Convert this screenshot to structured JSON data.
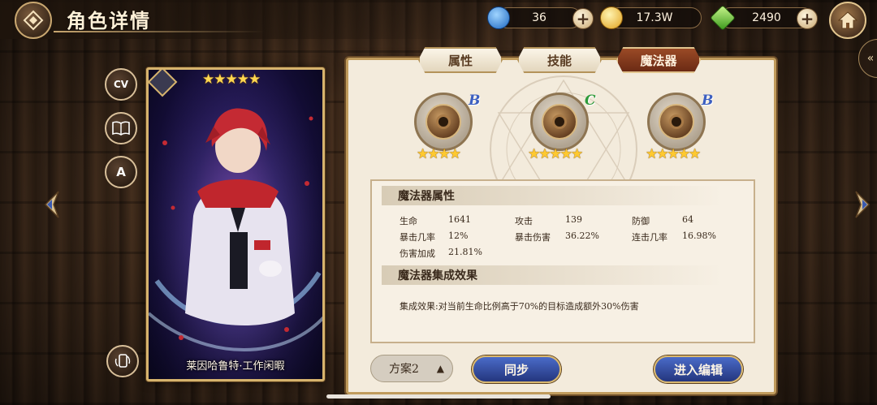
{
  "header": {
    "title": "角色详情",
    "resources": [
      {
        "name": "gem",
        "value": "36",
        "color": "#3b8fe0"
      },
      {
        "name": "gold",
        "value": "17.3W",
        "color": "#f2c23b"
      },
      {
        "name": "crystal",
        "value": "2490",
        "color": "#7ccf3c"
      }
    ],
    "plus": "+"
  },
  "side_buttons": [
    {
      "name": "cv-button",
      "label": "CV"
    },
    {
      "name": "story-button",
      "label": "📖"
    },
    {
      "name": "translate-button",
      "label": "A"
    }
  ],
  "card": {
    "stars": "★★★★★",
    "name": "莱因哈鲁特·工作闲暇"
  },
  "tabs": [
    {
      "label": "属性",
      "active": false
    },
    {
      "label": "技能",
      "active": false
    },
    {
      "label": "魔法器",
      "active": true
    }
  ],
  "devices": [
    {
      "grade": "B",
      "grade_color": "#3c5fc0",
      "stars": "★★★★",
      "star_count": 4
    },
    {
      "grade": "C",
      "grade_color": "#2e9a3a",
      "stars": "★★★★★",
      "star_count": 5
    },
    {
      "grade": "B",
      "grade_color": "#3c5fc0",
      "stars": "★★★★★",
      "star_count": 5
    }
  ],
  "attributes": {
    "title": "魔法器属性",
    "rows": [
      [
        {
          "label": "生命",
          "value": "1641"
        },
        {
          "label": "攻击",
          "value": "139"
        },
        {
          "label": "防御",
          "value": "64"
        }
      ],
      [
        {
          "label": "暴击几率",
          "value": "12%"
        },
        {
          "label": "暴击伤害",
          "value": "36.22%"
        },
        {
          "label": "连击几率",
          "value": "16.98%"
        }
      ],
      [
        {
          "label": "伤害加成",
          "value": "21.81%"
        }
      ]
    ]
  },
  "effect": {
    "title": "魔法器集成效果",
    "text": "集成效果:对当前生命比例高于70%的目标造成额外30%伤害"
  },
  "footer": {
    "plan": "方案2",
    "plan_arrow": "▲",
    "sync": "同步",
    "edit": "进入编辑"
  },
  "right_tab_glyph": "«"
}
